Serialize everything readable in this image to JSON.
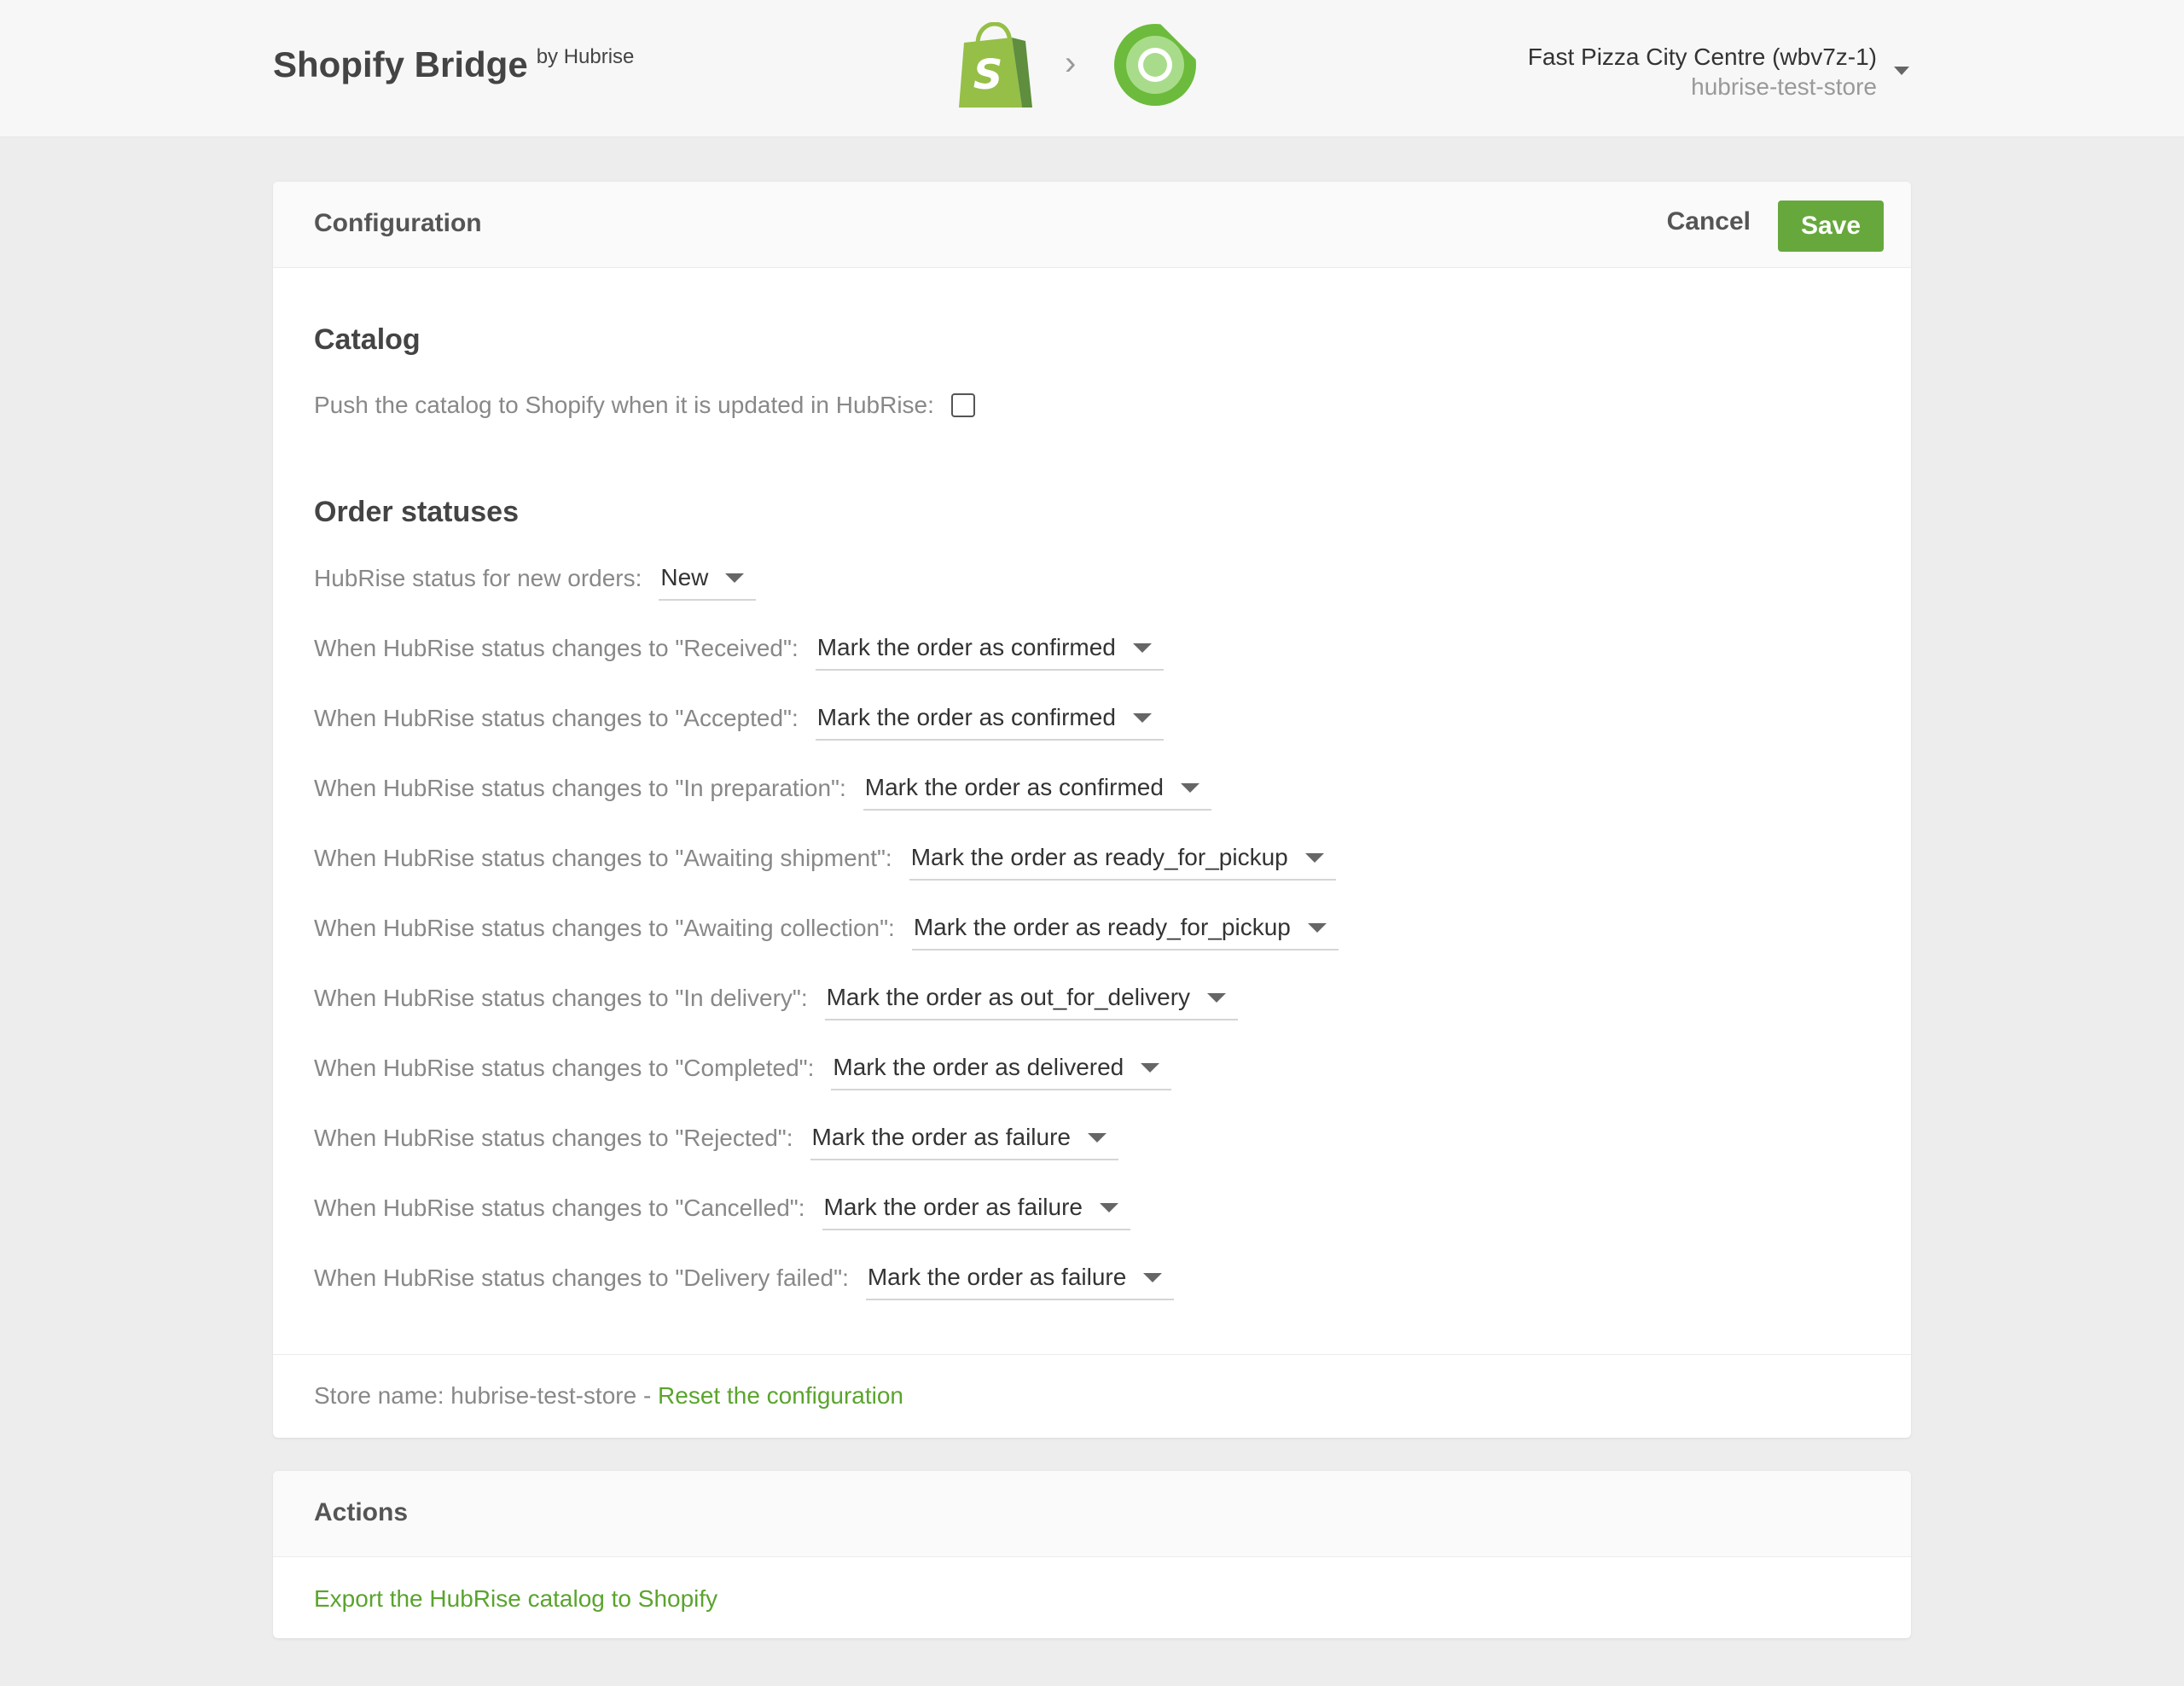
{
  "header": {
    "brand_title": "Shopify Bridge",
    "brand_by": "by Hubrise",
    "separator": "›",
    "account_name": "Fast Pizza City Centre (wbv7z-1)",
    "account_store": "hubrise-test-store"
  },
  "config": {
    "title": "Configuration",
    "cancel_label": "Cancel",
    "save_label": "Save",
    "catalog_title": "Catalog",
    "catalog_push_label": "Push the catalog to Shopify when it is updated in HubRise:",
    "catalog_push_checked": false,
    "statuses_title": "Order statuses",
    "new_orders_label": "HubRise status for new orders:",
    "new_orders_value": "New",
    "status_rows": [
      {
        "label": "When HubRise status changes to \"Received\":",
        "value": "Mark the order as confirmed"
      },
      {
        "label": "When HubRise status changes to \"Accepted\":",
        "value": "Mark the order as confirmed"
      },
      {
        "label": "When HubRise status changes to \"In preparation\":",
        "value": "Mark the order as confirmed"
      },
      {
        "label": "When HubRise status changes to \"Awaiting shipment\":",
        "value": "Mark the order as ready_for_pickup"
      },
      {
        "label": "When HubRise status changes to \"Awaiting collection\":",
        "value": "Mark the order as ready_for_pickup"
      },
      {
        "label": "When HubRise status changes to \"In delivery\":",
        "value": "Mark the order as out_for_delivery"
      },
      {
        "label": "When HubRise status changes to \"Completed\":",
        "value": "Mark the order as delivered"
      },
      {
        "label": "When HubRise status changes to \"Rejected\":",
        "value": "Mark the order as failure"
      },
      {
        "label": "When HubRise status changes to \"Cancelled\":",
        "value": "Mark the order as failure"
      },
      {
        "label": "When HubRise status changes to \"Delivery failed\":",
        "value": "Mark the order as failure"
      }
    ],
    "footer_store_text": "Store name: hubrise-test-store - ",
    "footer_reset_link": "Reset the configuration"
  },
  "actions": {
    "title": "Actions",
    "export_link": "Export the HubRise catalog to Shopify"
  },
  "colors": {
    "accent": "#67a83d",
    "link": "#5aa42d",
    "background": "#ededed"
  },
  "icons": {
    "shopify_logo": "shopify-bag-icon",
    "hubrise_logo": "hubrise-ring-icon",
    "separator": "chevron-right-icon",
    "account_menu": "chevron-down-icon"
  }
}
